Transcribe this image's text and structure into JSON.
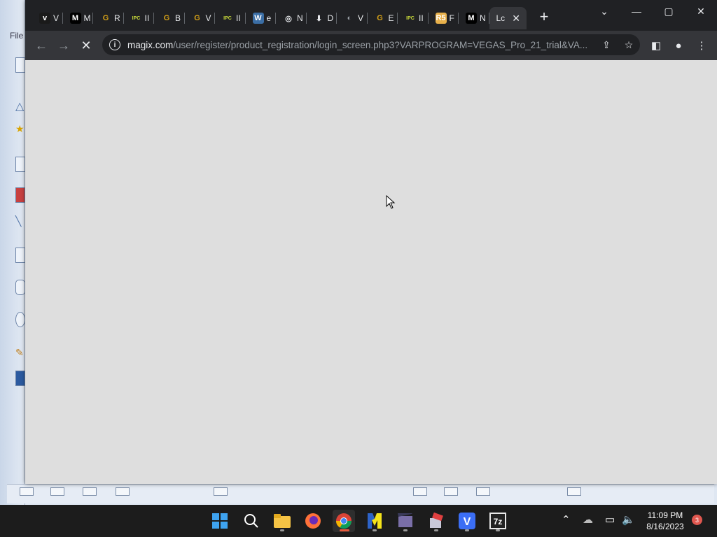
{
  "background_app": {
    "menu_label": "File"
  },
  "browser": {
    "tabs": [
      {
        "icon": "vegas-icon",
        "glyph": "v",
        "label": "V",
        "color": "#1a1a1a",
        "fg": "#ffffff"
      },
      {
        "icon": "medium-icon",
        "glyph": "M",
        "label": "M",
        "color": "#000000",
        "fg": "#ffffff"
      },
      {
        "icon": "g-icon",
        "glyph": "G",
        "label": "R",
        "color": "#202124",
        "fg": "#d4a017"
      },
      {
        "icon": "ipc-games-icon",
        "glyph": "IPC",
        "label": "II",
        "color": "#202124",
        "fg": "#c7d83a"
      },
      {
        "icon": "g-icon",
        "glyph": "G",
        "label": "B",
        "color": "#202124",
        "fg": "#d4a017"
      },
      {
        "icon": "g-icon",
        "glyph": "G",
        "label": "V",
        "color": "#202124",
        "fg": "#d4a017"
      },
      {
        "icon": "ipc-games-icon",
        "glyph": "IPC",
        "label": "II",
        "color": "#202124",
        "fg": "#c7d83a"
      },
      {
        "icon": "wordpress-icon",
        "glyph": "W",
        "label": "e",
        "color": "#3b6ea5",
        "fg": "#ffffff"
      },
      {
        "icon": "chrome-icon",
        "glyph": "◎",
        "label": "N",
        "color": "#202124",
        "fg": "#e8eaed"
      },
      {
        "icon": "download-icon",
        "glyph": "⬇",
        "label": "D",
        "color": "#202124",
        "fg": "#e8eaed"
      },
      {
        "icon": "globe-icon",
        "glyph": "◐",
        "label": "V",
        "color": "#202124",
        "fg": "#9aa0a6"
      },
      {
        "icon": "g-icon",
        "glyph": "G",
        "label": "E",
        "color": "#202124",
        "fg": "#d4a017"
      },
      {
        "icon": "ipc-games-icon",
        "glyph": "IPC",
        "label": "II",
        "color": "#202124",
        "fg": "#c7d83a"
      },
      {
        "icon": "r5-icon",
        "glyph": "R5",
        "label": "F",
        "color": "#e8b04a",
        "fg": "#ffffff"
      },
      {
        "icon": "medium-icon",
        "glyph": "M",
        "label": "N",
        "color": "#000000",
        "fg": "#ffffff"
      },
      {
        "icon": "loading-icon",
        "glyph": "",
        "label": "Lc",
        "color": "#35363a",
        "fg": "#e8eaed"
      }
    ],
    "url_host": "magix.com",
    "url_path": "/user/register/product_registration/login_screen.php3?VARPROGRAM=VEGAS_Pro_21_trial&VA..."
  },
  "taskbar": {
    "time": "11:09 PM",
    "date": "8/16/2023",
    "notification_count": "3"
  }
}
